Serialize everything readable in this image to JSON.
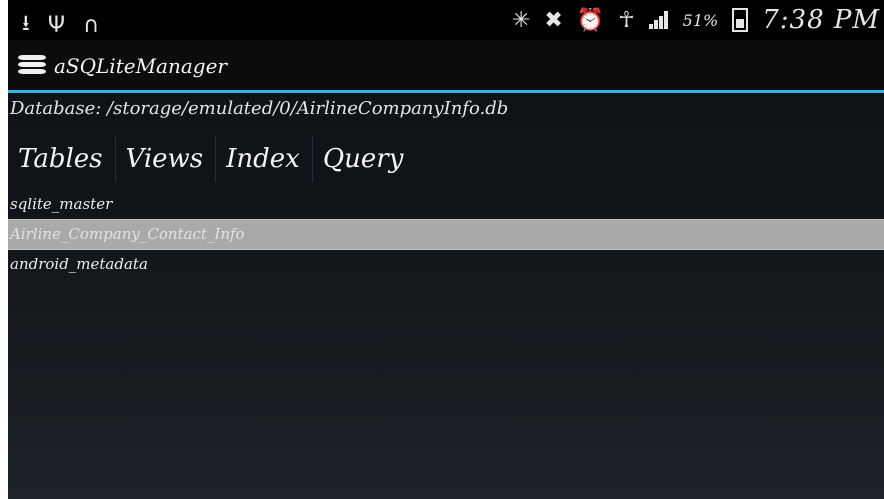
{
  "status_bar": {
    "left_icons": [
      "download-icon",
      "usb-icon",
      "headphones-icon"
    ],
    "right_icons": [
      "bluetooth-icon",
      "mute-icon",
      "alarm-icon",
      "wifi-icon",
      "signal-icon"
    ],
    "battery_percent": "51%",
    "time": "7:38 PM"
  },
  "app": {
    "title": "aSQLiteManager",
    "icon": "database-icon"
  },
  "database_path": "Database: /storage/emulated/0/AirlineCompanyInfo.db",
  "tabs": [
    {
      "label": "Tables"
    },
    {
      "label": "Views"
    },
    {
      "label": "Index"
    },
    {
      "label": "Query"
    }
  ],
  "tables": [
    {
      "name": "sqlite_master",
      "selected": false
    },
    {
      "name": "Airline_Company_Contact_Info",
      "selected": true
    },
    {
      "name": "android_metadata",
      "selected": false
    }
  ],
  "colors": {
    "accent": "#33b5e5",
    "selection": "#a9a9a9"
  }
}
